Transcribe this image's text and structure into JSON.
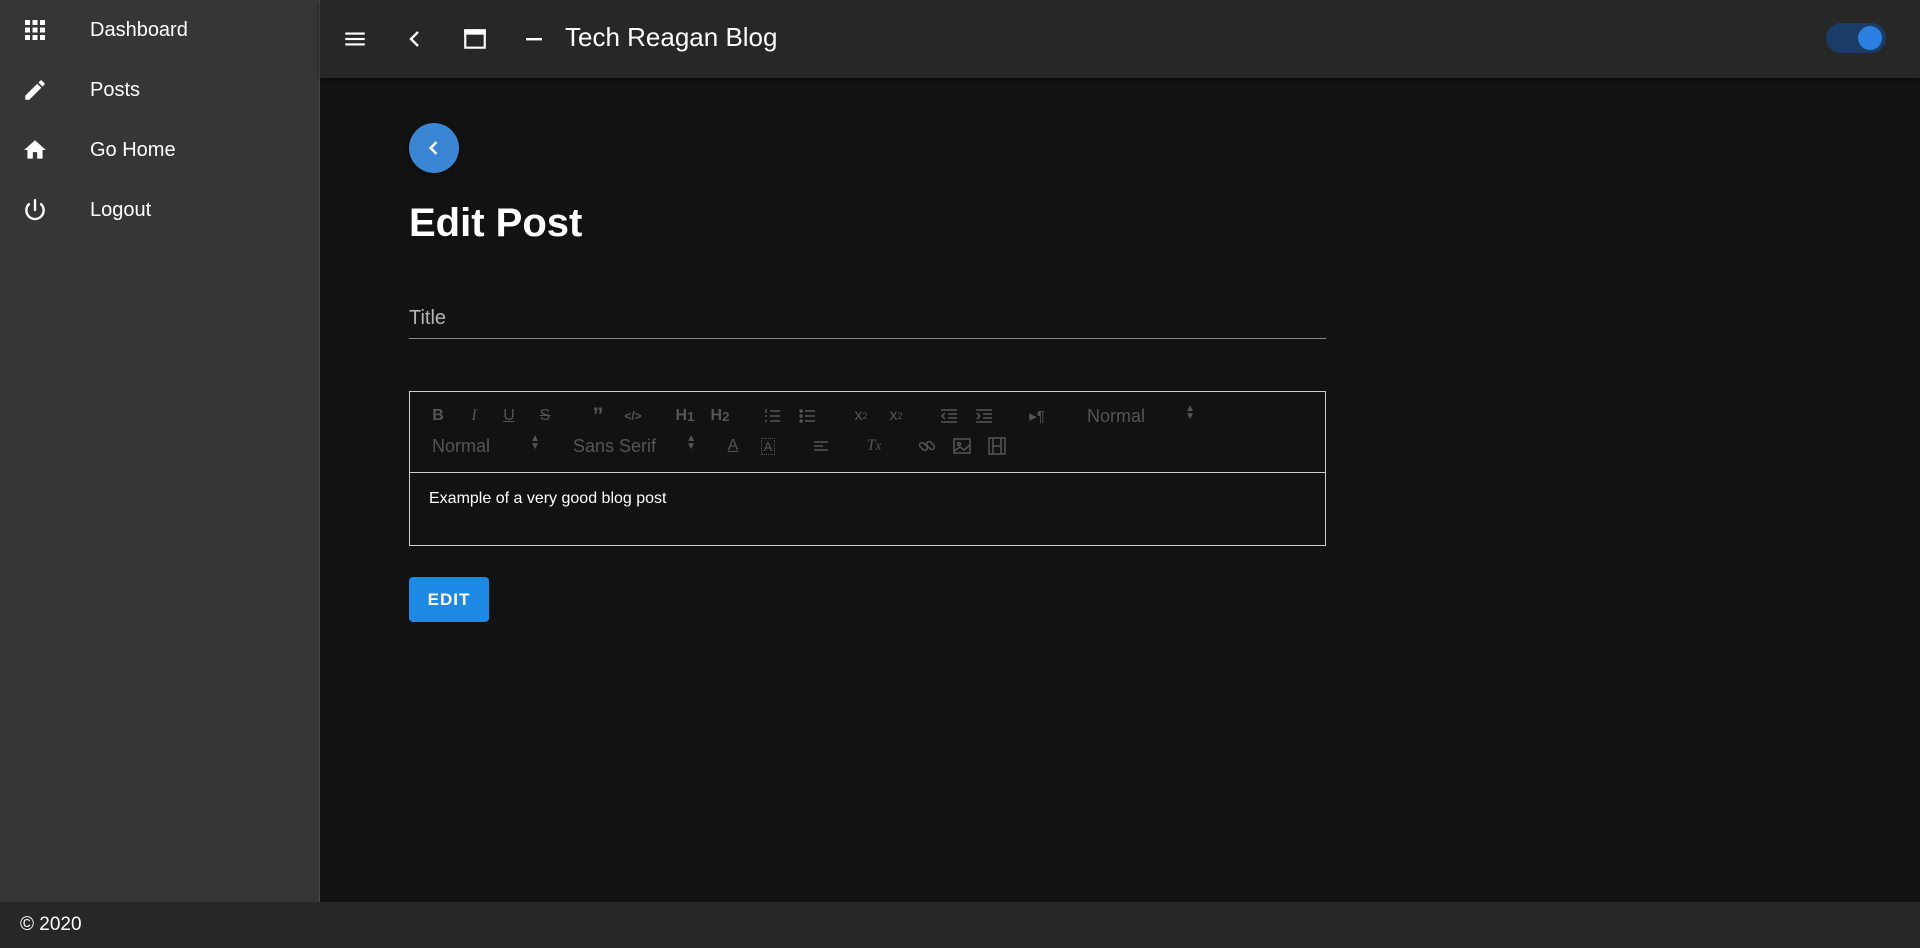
{
  "sidebar": {
    "items": [
      {
        "label": "Dashboard",
        "icon": "grid-icon"
      },
      {
        "label": "Posts",
        "icon": "pencil-icon"
      },
      {
        "label": "Go Home",
        "icon": "home-icon"
      },
      {
        "label": "Logout",
        "icon": "power-icon"
      }
    ]
  },
  "topbar": {
    "title": "Tech Reagan Blog",
    "icons": [
      "menu-icon",
      "chevron-left-icon",
      "window-icon",
      "minimize-icon"
    ],
    "dark_mode_toggle": {
      "on": true
    }
  },
  "main": {
    "heading": "Edit Post",
    "title_field": {
      "placeholder": "Title",
      "value": ""
    },
    "editor": {
      "header_picker": "Normal",
      "size_picker": "Normal",
      "font_picker": "Sans Serif",
      "content": "Example of a very good blog post"
    },
    "edit_button": "EDIT"
  },
  "footer": {
    "text": "© 2020"
  },
  "colors": {
    "accent": "#1e88e5",
    "background": "#121212",
    "sidebar": "#363636",
    "topbar": "#272727"
  }
}
